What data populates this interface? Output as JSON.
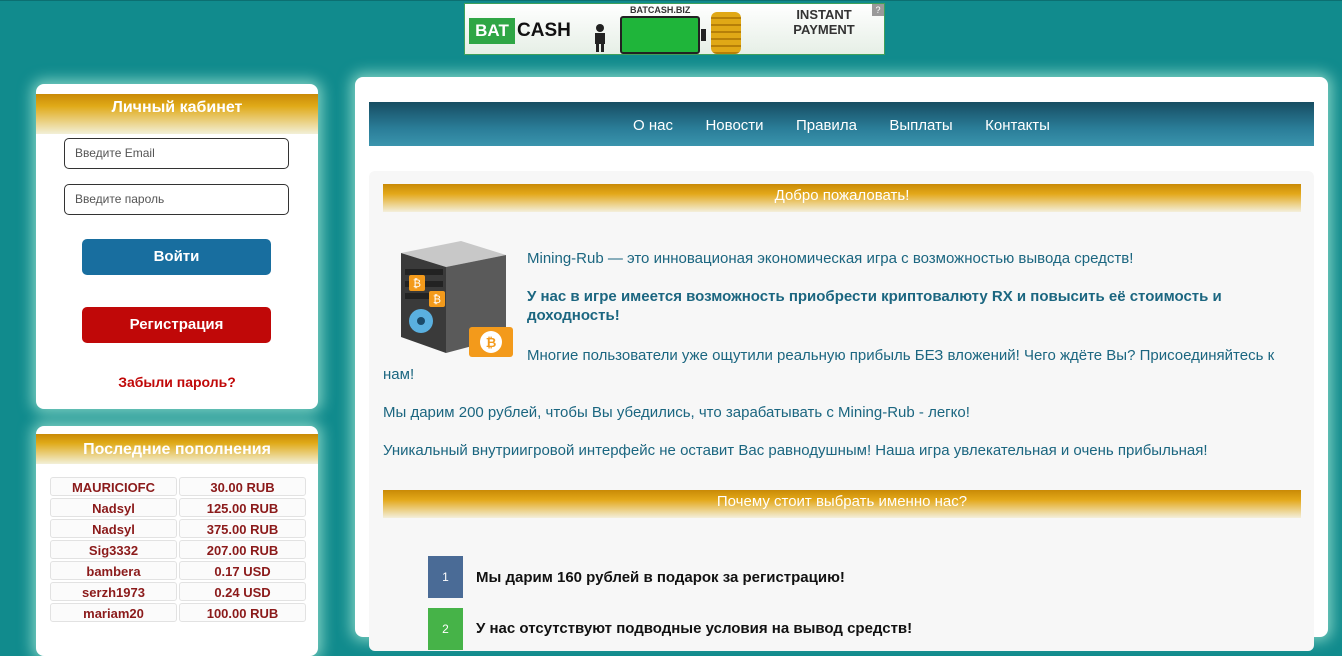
{
  "banner": {
    "bat": "BAT",
    "cash": "CASH",
    "site": "BATCASH.BIZ",
    "instant_line1": "INSTANT",
    "instant_line2": "PAYMENT",
    "help": "?"
  },
  "login": {
    "title": "Личный кабинет",
    "email_placeholder": "Введите Email",
    "password_placeholder": "Введите пароль",
    "login_button": "Войти",
    "register_button": "Регистрация",
    "forgot_link": "Забыли пароль?"
  },
  "deposits": {
    "title": "Последние пополнения",
    "rows": [
      {
        "name": "MAURICIOFC",
        "amount": "30.00 RUB"
      },
      {
        "name": "Nadsyl",
        "amount": "125.00 RUB"
      },
      {
        "name": "Nadsyl",
        "amount": "375.00 RUB"
      },
      {
        "name": "Sig3332",
        "amount": "207.00 RUB"
      },
      {
        "name": "bambera",
        "amount": "0.17 USD"
      },
      {
        "name": "serzh1973",
        "amount": "0.24 USD"
      },
      {
        "name": "mariam20",
        "amount": "100.00 RUB"
      }
    ]
  },
  "nav": {
    "items": [
      "О нас",
      "Новости",
      "Правила",
      "Выплаты",
      "Контакты"
    ]
  },
  "welcome": {
    "title": "Добро пожаловать!",
    "p1": "Mining-Rub — это инновационая экономическая игра с возможностью вывода средств!",
    "p2": "У нас в игре имеется возможность приобрести криптовалюту RX и повысить её стоимость и доходность!",
    "p3": "Многие пользователи уже ощутили реальную прибыль БЕЗ вложений! Чего ждёте Вы? Присоединяйтесь к нам!",
    "p4": "Мы дарим 200 рублей, чтобы Вы убедились, что зарабатывать с Mining-Rub - легко!",
    "p5": "Уникальный внутриигровой интерфейс не оставит Вас равнодушным! Наша игра увлекательная и очень прибыльная!"
  },
  "why": {
    "title": "Почему стоит выбрать именно нас?",
    "items": [
      {
        "num": "1",
        "text": "Мы дарим 160 рублей в подарок за регистрацию!"
      },
      {
        "num": "2",
        "text": "У нас отсутствуют подводные условия на вывод средств!"
      }
    ]
  },
  "colors": {
    "background": "#118b8d",
    "accent_gold": "#e0aa18",
    "nav_blue": "#2a7d98",
    "danger": "#c00808"
  }
}
